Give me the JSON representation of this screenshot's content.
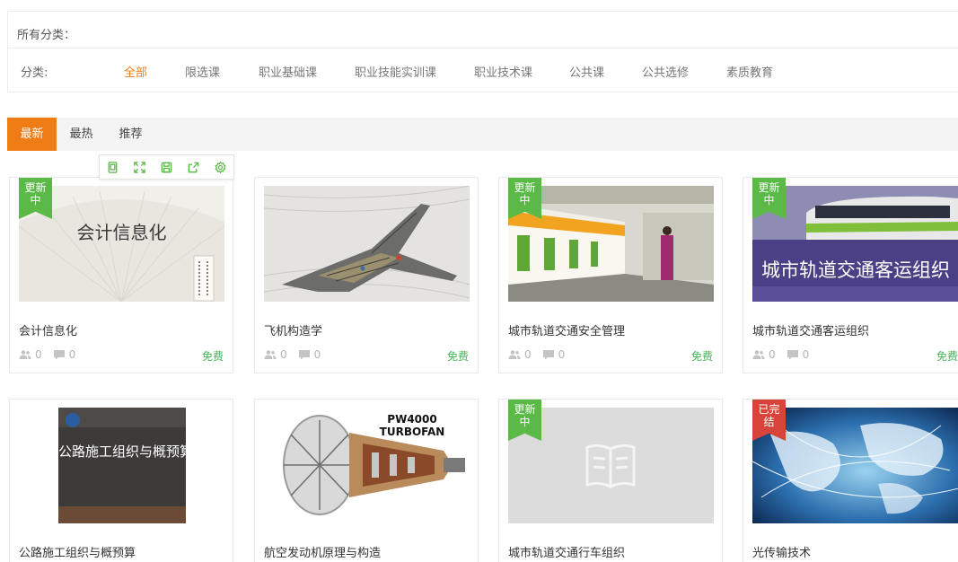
{
  "filter": {
    "all_categories": "所有分类：",
    "label": "分类:",
    "items": [
      "全部",
      "限选课",
      "职业基础课",
      "职业技能实训课",
      "职业技术课",
      "公共课",
      "公共选修",
      "素质教育"
    ],
    "active_index": 0
  },
  "tabs": {
    "items": [
      "最新",
      "最热",
      "推荐"
    ],
    "active_index": 0
  },
  "toolbar": {
    "icons": [
      "page-icon",
      "fullscreen-icon",
      "save-icon",
      "share-icon",
      "settings-icon"
    ]
  },
  "colors": {
    "accent": "#f07c16",
    "price_green": "#47b35a",
    "ribbon_green": "#5ab947",
    "ribbon_red": "#d9443a"
  },
  "courses": [
    {
      "title": "会计信息化",
      "students": "0",
      "comments": "0",
      "price": "免费",
      "badge": "更新中",
      "badge_color": "green",
      "cover_text": "会计信息化"
    },
    {
      "title": "飞机构造学",
      "students": "0",
      "comments": "0",
      "price": "免费",
      "badge": "",
      "badge_color": "",
      "cover_text": ""
    },
    {
      "title": "城市轨道交通安全管理",
      "students": "0",
      "comments": "0",
      "price": "免费",
      "badge": "更新中",
      "badge_color": "green",
      "cover_text": ""
    },
    {
      "title": "城市轨道交通客运组织",
      "students": "0",
      "comments": "0",
      "price": "免费",
      "badge": "更新中",
      "badge_color": "green",
      "cover_text": "城市轨道交通客运组织"
    },
    {
      "title": "公路施工组织与概预算",
      "students": "",
      "comments": "",
      "price": "",
      "badge": "",
      "badge_color": "",
      "cover_text": "公路施工组织与概预算"
    },
    {
      "title": "航空发动机原理与构造",
      "students": "",
      "comments": "",
      "price": "",
      "badge": "",
      "badge_color": "",
      "cover_text": "PW4000 TURBOFAN"
    },
    {
      "title": "城市轨道交通行车组织",
      "students": "",
      "comments": "",
      "price": "",
      "badge": "更新中",
      "badge_color": "green",
      "cover_text": ""
    },
    {
      "title": "光传输技术",
      "students": "",
      "comments": "",
      "price": "",
      "badge": "已完结",
      "badge_color": "red",
      "cover_text": ""
    }
  ]
}
